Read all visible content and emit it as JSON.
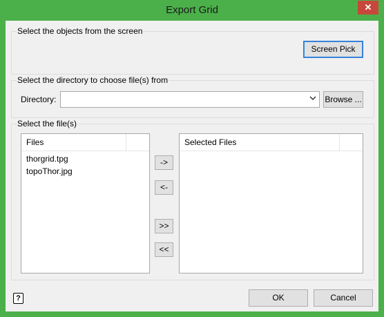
{
  "window": {
    "title": "Export Grid",
    "close_label": "✕"
  },
  "screen_group": {
    "label": "Select the objects from the screen",
    "screen_pick_label": "Screen Pick"
  },
  "directory_group": {
    "label": "Select the directory to choose file(s) from",
    "directory_label": "Directory:",
    "directory_value": "",
    "browse_label": "Browse ..."
  },
  "files_group": {
    "label": "Select the file(s)",
    "files_header": "Files",
    "files": [
      "thorgrid.tpg",
      "topoThor.jpg"
    ],
    "selected_header": "Selected Files",
    "selected_files": [],
    "move_right_label": "->",
    "move_left_label": "<-",
    "move_all_right_label": ">>",
    "move_all_left_label": "<<"
  },
  "footer": {
    "help_icon": "help-icon",
    "help_glyph": "?",
    "ok_label": "OK",
    "cancel_label": "Cancel"
  }
}
